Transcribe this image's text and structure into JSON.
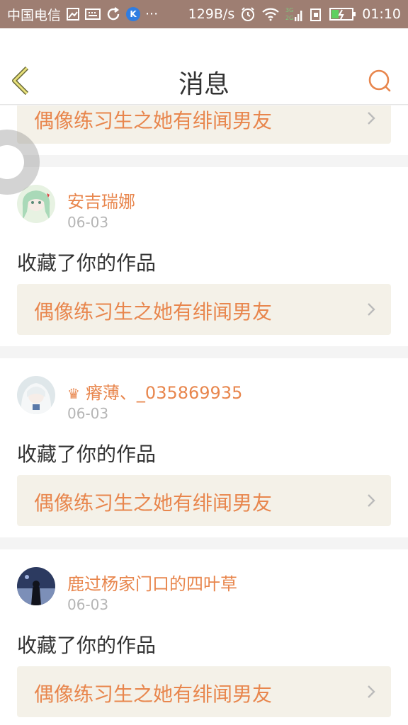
{
  "status_bar": {
    "carrier": "中国电信",
    "speed": "129B/s",
    "net_3g": "3G",
    "net_2g": "2G",
    "time": "01:10",
    "k_badge": "K",
    "more": "···"
  },
  "header": {
    "title": "消息"
  },
  "colors": {
    "accent": "#e8864d",
    "status_bar_bg": "#9e7e72",
    "work_link_bg": "#f4f1e8"
  },
  "feed": {
    "top_partial": {
      "work_title": "偶像练习生之她有绯闻男友"
    },
    "items": [
      {
        "username": "安吉瑞娜",
        "date": "06-03",
        "action": "收藏了你的作品",
        "work_title": "偶像练习生之她有绯闻男友",
        "has_crown": false
      },
      {
        "username": "瘠薄、_035869935",
        "date": "06-03",
        "action": "收藏了你的作品",
        "work_title": "偶像练习生之她有绯闻男友",
        "has_crown": true
      },
      {
        "username": "鹿过杨家门口的四叶草",
        "date": "06-03",
        "action": "收藏了你的作品",
        "work_title": "偶像练习生之她有绯闻男友",
        "has_crown": false
      }
    ]
  },
  "icons": [
    "back-chevron-icon",
    "search-icon",
    "chevron-right-icon",
    "crown-icon",
    "wifi-icon",
    "battery-icon",
    "alarm-icon",
    "sync-icon",
    "keyboard-icon",
    "image-icon",
    "sim-icon"
  ]
}
